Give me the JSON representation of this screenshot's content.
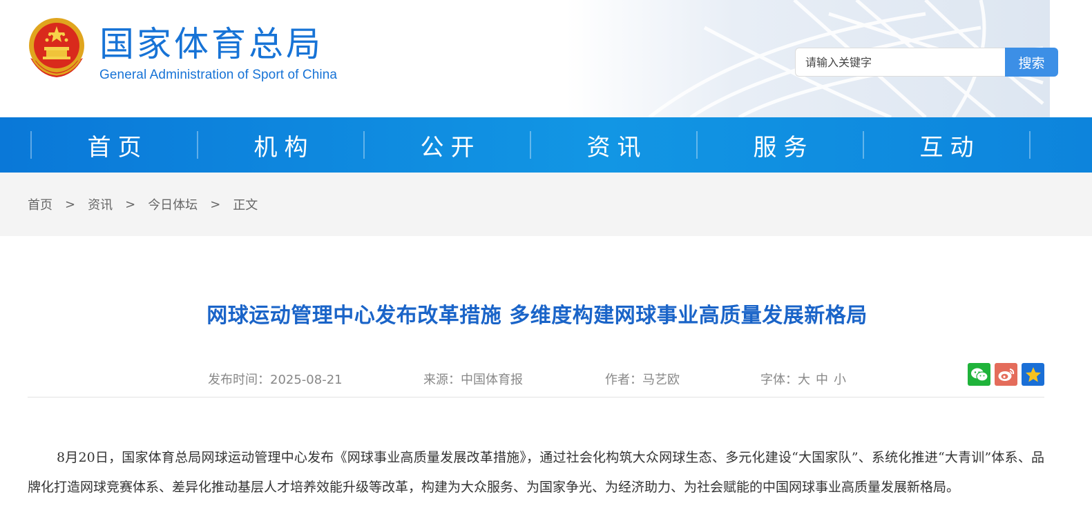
{
  "header": {
    "site_name_cn": "国家体育总局",
    "site_name_en": "General Administration of Sport of China"
  },
  "search": {
    "placeholder": "请输入关键字",
    "button_label": "搜索"
  },
  "nav": {
    "items": [
      {
        "label": "首页"
      },
      {
        "label": "机构"
      },
      {
        "label": "公开"
      },
      {
        "label": "资讯"
      },
      {
        "label": "服务"
      },
      {
        "label": "互动"
      }
    ]
  },
  "breadcrumb": {
    "items": [
      "首页",
      "资讯",
      "今日体坛"
    ],
    "separator": ">",
    "current": "正文"
  },
  "article": {
    "title": "网球运动管理中心发布改革措施 多维度构建网球事业高质量发展新格局",
    "meta": {
      "date_label": "发布时间：2025-08-21",
      "source_label": "来源：中国体育报",
      "author_label": "作者：马艺欧",
      "font_label": "字体：",
      "font_options": [
        "大",
        "中",
        "小"
      ]
    },
    "share": {
      "icons": [
        "wechat-icon",
        "weibo-icon",
        "favorite-star-icon"
      ]
    },
    "paragraph": "8月20日，国家体育总局网球运动管理中心发布《网球事业高质量发展改革措施》，通过社会化构筑大众网球生态、多元化建设“大国家队”、系统化推进“大青训”体系、品牌化打造网球竞赛体系、差异化推动基层人才培养效能升级等改革，构建为大众服务、为国家争光、为经济助力、为社会赋能的中国网球事业高质量发展新格局。"
  },
  "colors": {
    "brand_blue": "#1773d6",
    "nav_blue": "#0a78d8",
    "title_blue": "#1a64c8",
    "search_button": "#3c8fe6"
  }
}
